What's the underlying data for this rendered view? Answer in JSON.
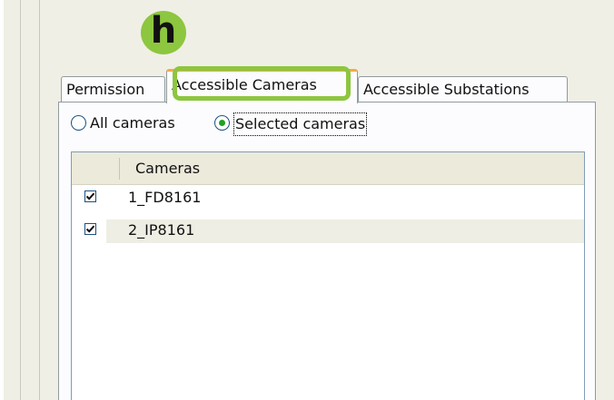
{
  "marker": {
    "label": "h",
    "color": "#8dc63f"
  },
  "tabs": [
    {
      "label": "Permission",
      "selected": false
    },
    {
      "label": "Accessible Cameras",
      "selected": true
    },
    {
      "label": "Accessible Substations",
      "selected": false
    }
  ],
  "highlight_color": "#8dc63f",
  "access_mode": {
    "options": [
      {
        "label": "All cameras",
        "checked": false
      },
      {
        "label": "Selected cameras",
        "checked": true
      }
    ]
  },
  "camera_list": {
    "column_header": "Cameras",
    "rows": [
      {
        "name": "1_FD8161",
        "checked": true
      },
      {
        "name": "2_IP8161",
        "checked": true
      }
    ]
  }
}
